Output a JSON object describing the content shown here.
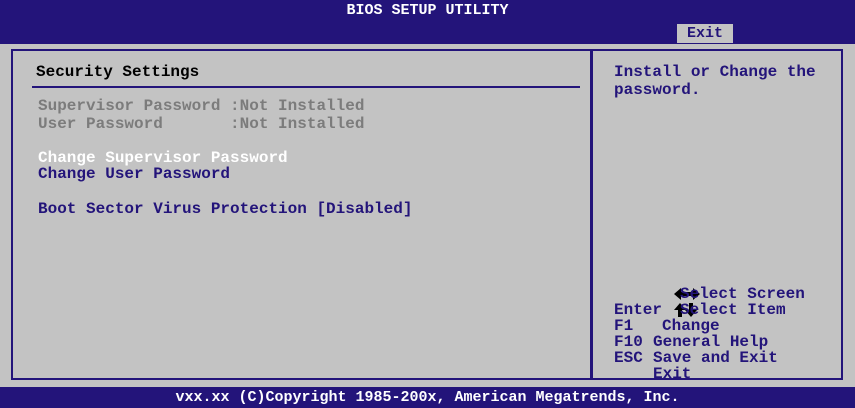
{
  "header": {
    "title": "BIOS SETUP UTILITY",
    "active_tab": "Exit"
  },
  "left_panel": {
    "title": "Security Settings",
    "supervisor_password": "Supervisor Password :Not Installed",
    "user_password": "User Password       :Not Installed",
    "change_supervisor": "Change Supervisor Password",
    "change_user": "Change User Password",
    "boot_sector": "Boot Sector Virus Protection [Disabled]"
  },
  "right_panel": {
    "help_text": "Install or Change the password.",
    "keys": [
      {
        "key": "",
        "desc": "Select Screen",
        "icon": "left-right-arrows-icon"
      },
      {
        "key": "",
        "desc": "Select Item",
        "icon": "up-down-arrows-icon"
      },
      {
        "key": "Enter",
        "desc": "Change"
      },
      {
        "key": "F1",
        "desc": "General Help"
      },
      {
        "key": "F10",
        "desc": "Save and Exit"
      },
      {
        "key": "ESC",
        "desc": "Exit"
      }
    ]
  },
  "footer": {
    "copyright": "vxx.xx (C)Copyright 1985-200x, American Megatrends, Inc."
  },
  "colors": {
    "dark_blue": "#23147a",
    "panel_gray": "#c3c3c3",
    "disabled_gray": "#7c7c7c",
    "white": "#ffffff"
  }
}
